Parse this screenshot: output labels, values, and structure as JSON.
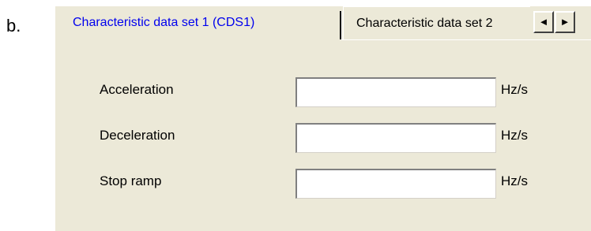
{
  "figure_label": "b.",
  "tabs": [
    {
      "label": "Characteristic data set 1 (CDS1)",
      "active": true
    },
    {
      "label": "Characteristic data set 2",
      "active": false
    }
  ],
  "scroll_buttons": {
    "left_glyph": "◄",
    "right_glyph": "►"
  },
  "fields": [
    {
      "label": "Acceleration",
      "value": "",
      "unit": "Hz/s"
    },
    {
      "label": "Deceleration",
      "value": "",
      "unit": "Hz/s"
    },
    {
      "label": "Stop ramp",
      "value": "",
      "unit": "Hz/s"
    }
  ]
}
